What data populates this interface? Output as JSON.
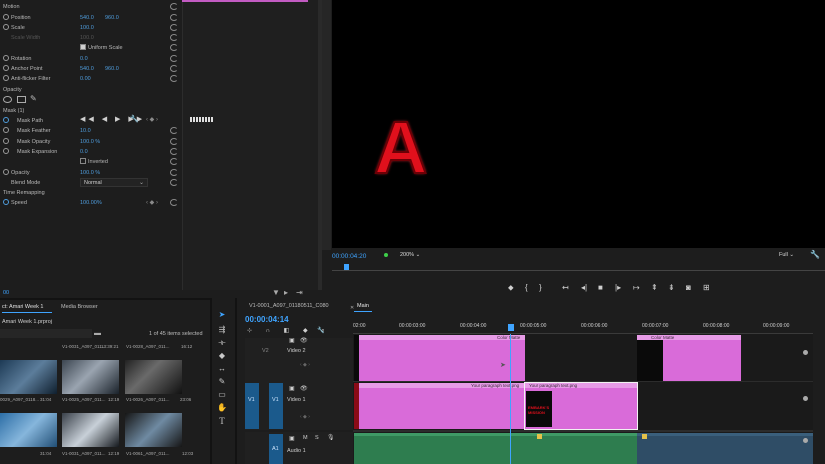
{
  "effect_controls": {
    "motion_label": "Motion",
    "position_label": "Position",
    "position_x": "540.0",
    "position_y": "960.0",
    "scale_label": "Scale",
    "scale_value": "100.0",
    "scale_width_label": "Scale Width",
    "scale_width_value": "100.0",
    "uniform_scale_label": "Uniform Scale",
    "rotation_label": "Rotation",
    "rotation_value": "0.0",
    "anchor_label": "Anchor Point",
    "anchor_x": "540.0",
    "anchor_y": "960.0",
    "antiflicker_label": "Anti-flicker Filter",
    "antiflicker_value": "0.00",
    "opacity_section_label": "Opacity",
    "mask_label": "Mask (1)",
    "mask_path_label": "Mask Path",
    "mask_feather_label": "Mask Feather",
    "mask_feather_value": "10.0",
    "mask_opacity_label": "Mask Opacity",
    "mask_opacity_value": "100.0 %",
    "mask_expansion_label": "Mask Expansion",
    "mask_expansion_value": "0.0",
    "inverted_label": "Inverted",
    "opacity_label": "Opacity",
    "opacity_value": "100.0 %",
    "blend_mode_label": "Blend Mode",
    "blend_mode_value": "Normal",
    "time_remap_label": "Time Remapping",
    "speed_label": "Speed",
    "speed_value": "100.00%",
    "bottom_timecode": "00"
  },
  "program_monitor": {
    "preview_letter": "A",
    "timecode": "00:00:04:20",
    "zoom": "200%",
    "quality": "Full",
    "accent_color": "#3fa4ff"
  },
  "project_panel": {
    "tab_project": "ct: Amari Week 1",
    "tab_media_browser": "Media Browser",
    "project_file": "Amari Week 1.prproj",
    "item_count": "1 of 45 items selected",
    "thumbs": [
      {
        "name": "",
        "dur": "31:04"
      },
      {
        "name": "V1-0031_A097_011...",
        "dur": "13:39:21"
      },
      {
        "name": "V1-0028_A097_011...",
        "dur": "16:12"
      },
      {
        "name": "0029_A097_0118...",
        "dur": "31:04"
      },
      {
        "name": "V1-0025_A097_011...",
        "dur": "12:19"
      },
      {
        "name": "V1-0026_A097_011...",
        "dur": "23:06"
      },
      {
        "name": "V1-0032_A097_011...",
        "dur": "31:04"
      },
      {
        "name": "V1-0031_A097_011...",
        "dur": "12:19"
      },
      {
        "name": "V1-0061_A097_011...",
        "dur": "12:03"
      }
    ]
  },
  "timeline": {
    "sequence_tab": "V1-0001_A097_01180511_C080",
    "main_tab": "Main",
    "timecode": "00:00:04:14",
    "ticks": [
      "02:00",
      "00:00:03:00",
      "00:00:04:00",
      "00:00:05:00",
      "00:00:06:00",
      "00:00:07:00",
      "00:00:08:00",
      "00:00:09:00"
    ],
    "tracks": {
      "v2_label": "V2",
      "v2_name": "Video 2",
      "v1_label": "V1",
      "v1_name": "Video 1",
      "v1_source": "V1",
      "a1_label": "A1",
      "a1_name": "Audio 1",
      "m_label": "M",
      "s_label": "S"
    },
    "clips": {
      "color_matte_1": "Color Matte",
      "color_matte_2": "Color Matte",
      "text_png_1": "Your paragraph text.png",
      "text_png_2": "Your paragraph text.png",
      "thumb_text": "EMBARK'S MISSION"
    },
    "clip_color": "#d96bd9",
    "audio_color": "#2e7d4f"
  }
}
